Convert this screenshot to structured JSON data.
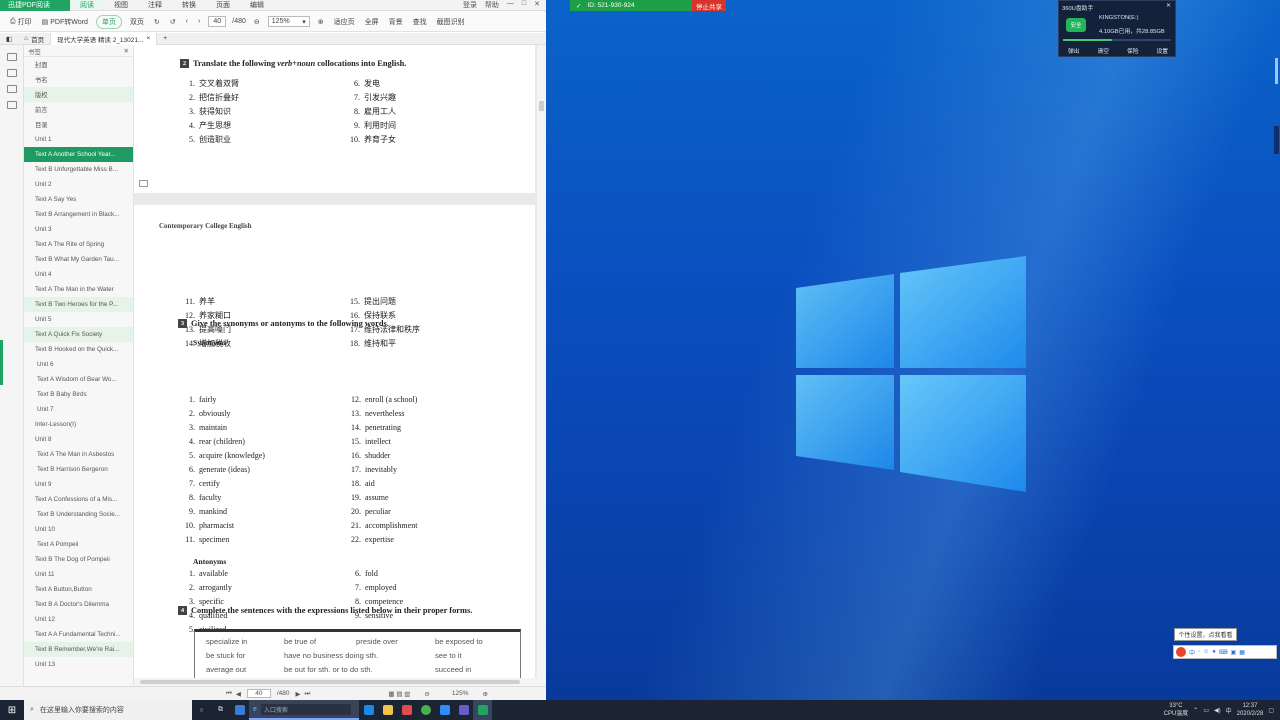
{
  "app": {
    "brand": "迅捷PDF阅读",
    "menus": [
      "阅读",
      "视图",
      "注释",
      "转换",
      "页面",
      "编辑"
    ],
    "active_menu": "阅读",
    "top_right": [
      "登录",
      "帮助"
    ],
    "toolbar": {
      "print": "打印",
      "pdf_to_word": "PDF转Word",
      "single": "单页",
      "double": "双页",
      "page_value": "40",
      "page_total": "/480",
      "zoom": "125%",
      "tools": [
        "适应页",
        "全屏",
        "背景",
        "查找",
        "截图识别"
      ]
    },
    "tabs": [
      "首页",
      "现代大学英语 精读 2_13021..."
    ],
    "outline_title": "书签",
    "outline": [
      {
        "label": "封面",
        "state": ""
      },
      {
        "label": "书名",
        "state": ""
      },
      {
        "label": "版权",
        "state": "hl"
      },
      {
        "label": "前言",
        "state": ""
      },
      {
        "label": "目录",
        "state": ""
      },
      {
        "label": "Unit 1",
        "state": ""
      },
      {
        "label": "Text A  Another School Year...",
        "state": "sel"
      },
      {
        "label": "Text B  Unforgettable Miss B...",
        "state": ""
      },
      {
        "label": "Unit 2",
        "state": ""
      },
      {
        "label": "Text A  Say Yes",
        "state": ""
      },
      {
        "label": "Text B  Arrangement in Black...",
        "state": ""
      },
      {
        "label": "Unit 3",
        "state": ""
      },
      {
        "label": "Text A  The Rite of Spring",
        "state": ""
      },
      {
        "label": "Text B  What My Garden Tau...",
        "state": ""
      },
      {
        "label": "Unit 4",
        "state": ""
      },
      {
        "label": "Text A  The Man in the Water",
        "state": ""
      },
      {
        "label": "Text B  Two Heroes for the P...",
        "state": "hl"
      },
      {
        "label": "Unit 5",
        "state": ""
      },
      {
        "label": "Text A  Quick Fix Society",
        "state": "hl"
      },
      {
        "label": "Text B  Hooked on the Quick...",
        "state": ""
      },
      {
        "label": "Unit 6",
        "state": "i"
      },
      {
        "label": "Text A  Wisdom of Bear Wo...",
        "state": "i"
      },
      {
        "label": "Text B  Baby Birds",
        "state": "i"
      },
      {
        "label": "Unit 7",
        "state": "i"
      },
      {
        "label": "Inter-Lesson(Ⅰ)",
        "state": ""
      },
      {
        "label": "Unit 8",
        "state": ""
      },
      {
        "label": "Text A  The Man in Asbestos",
        "state": "i"
      },
      {
        "label": "Text B  Harrison Bergeron",
        "state": "i"
      },
      {
        "label": "Unit 9",
        "state": ""
      },
      {
        "label": "Text A  Confessions of a Mis...",
        "state": ""
      },
      {
        "label": "Text B  Understanding Socie...",
        "state": "i"
      },
      {
        "label": "Unit 10",
        "state": ""
      },
      {
        "label": "Text A  Pompeii",
        "state": "i"
      },
      {
        "label": "Text B  The Dog of Pompeii",
        "state": ""
      },
      {
        "label": "Unit 11",
        "state": ""
      },
      {
        "label": "Text A  Button,Button",
        "state": ""
      },
      {
        "label": "Text B  A Doctor's Dilemma",
        "state": ""
      },
      {
        "label": "Unit 12",
        "state": ""
      },
      {
        "label": "Text A  A Fundamental Techni...",
        "state": ""
      },
      {
        "label": "Text B  Remember,We're Rai...",
        "state": "hl"
      },
      {
        "label": "Unit 13",
        "state": ""
      }
    ],
    "status": {
      "page_value": "40",
      "page_total": "/480",
      "zoom": "125%"
    }
  },
  "document": {
    "section2": {
      "num": "2",
      "title_pre": "Translate the following ",
      "title_em": "verb+noun",
      "title_post": " collocations into English.",
      "left": [
        {
          "n": "1.",
          "t": "交叉着双臂"
        },
        {
          "n": "2.",
          "t": "把信折叠好"
        },
        {
          "n": "3.",
          "t": "获得知识"
        },
        {
          "n": "4.",
          "t": "产生思想"
        },
        {
          "n": "5.",
          "t": "创造职业"
        }
      ],
      "right": [
        {
          "n": "6.",
          "t": "发电"
        },
        {
          "n": "7.",
          "t": "引发兴趣"
        },
        {
          "n": "8.",
          "t": "雇用工人"
        },
        {
          "n": "9.",
          "t": "利用时间"
        },
        {
          "n": "10.",
          "t": "养育子女"
        }
      ]
    },
    "running_head": "Contemporary College English",
    "section2b": {
      "left": [
        {
          "n": "11.",
          "t": "养羊"
        },
        {
          "n": "12.",
          "t": "养家糊口"
        },
        {
          "n": "13.",
          "t": "提高嗓门"
        },
        {
          "n": "14.",
          "t": "增加税收"
        }
      ],
      "right": [
        {
          "n": "15.",
          "t": "提出问题"
        },
        {
          "n": "16.",
          "t": "保持联系"
        },
        {
          "n": "17.",
          "t": "维持法律和秩序"
        },
        {
          "n": "18.",
          "t": "维持和平"
        }
      ]
    },
    "section3": {
      "num": "3",
      "title": "Give the synonyms or antonyms to the following words.",
      "synonyms_label": "Synonyms",
      "syn_left": [
        {
          "n": "1.",
          "t": "fairly"
        },
        {
          "n": "2.",
          "t": "obviously"
        },
        {
          "n": "3.",
          "t": "maintain"
        },
        {
          "n": "4.",
          "t": "rear (children)"
        },
        {
          "n": "5.",
          "t": "acquire (knowledge)"
        },
        {
          "n": "6.",
          "t": "generate (ideas)"
        },
        {
          "n": "7.",
          "t": "certify"
        },
        {
          "n": "8.",
          "t": "faculty"
        },
        {
          "n": "9.",
          "t": "mankind"
        },
        {
          "n": "10.",
          "t": "pharmacist"
        },
        {
          "n": "11.",
          "t": "specimen"
        }
      ],
      "syn_right": [
        {
          "n": "12.",
          "t": "enroll (a school)"
        },
        {
          "n": "13.",
          "t": "nevertheless"
        },
        {
          "n": "14.",
          "t": "penetrating"
        },
        {
          "n": "15.",
          "t": "intellect"
        },
        {
          "n": "16.",
          "t": "shudder"
        },
        {
          "n": "17.",
          "t": "inevitably"
        },
        {
          "n": "18.",
          "t": "aid"
        },
        {
          "n": "19.",
          "t": "assume"
        },
        {
          "n": "20.",
          "t": "peculiar"
        },
        {
          "n": "21.",
          "t": "accomplishment"
        },
        {
          "n": "22.",
          "t": "expertise"
        }
      ],
      "antonyms_label": "Antonyms",
      "ant_left": [
        {
          "n": "1.",
          "t": "available"
        },
        {
          "n": "2.",
          "t": "arrogantly"
        },
        {
          "n": "3.",
          "t": "specific"
        },
        {
          "n": "4.",
          "t": "qualified"
        },
        {
          "n": "5.",
          "t": "civilized"
        }
      ],
      "ant_right": [
        {
          "n": "6.",
          "t": "fold"
        },
        {
          "n": "7.",
          "t": "employed"
        },
        {
          "n": "8.",
          "t": "competence"
        },
        {
          "n": "9.",
          "t": "sensitive"
        }
      ]
    },
    "section4": {
      "num": "4",
      "title": "Complete the sentences with the expressions listed below in their proper forms.",
      "box": [
        [
          "specialize in",
          "be true of",
          "preside over",
          "be exposed to"
        ],
        [
          "be stuck for",
          "have no business doing sth.",
          "see to it"
        ],
        [
          "average out",
          "be out for sth. or to do sth.",
          "succeed in"
        ]
      ]
    }
  },
  "share": {
    "id": "ID: 521-930-924",
    "stop": "停止共享"
  },
  "widget": {
    "title": "360U盘助手",
    "badge": "安全",
    "line1": "KINGSTON(E:)",
    "line2": "4.10GB已用，共28.85GB",
    "buttons": [
      "弹出",
      "清空",
      "保险",
      "设置"
    ]
  },
  "tooltip": "个性设置，点我看看",
  "ime": {
    "label": "中"
  },
  "taskbar": {
    "search_placeholder": "在这里输入你要搜索的内容",
    "ie_field": "入口搜索",
    "temp": "33°C",
    "temp_label": "CPU温度",
    "time": "12:37",
    "date": "2020/2/28",
    "lang": "中"
  },
  "colors": {
    "accent": "#1fa463",
    "selected": "#1f9a62",
    "stop": "#d9342b",
    "desktop": "#0a4fbf"
  }
}
